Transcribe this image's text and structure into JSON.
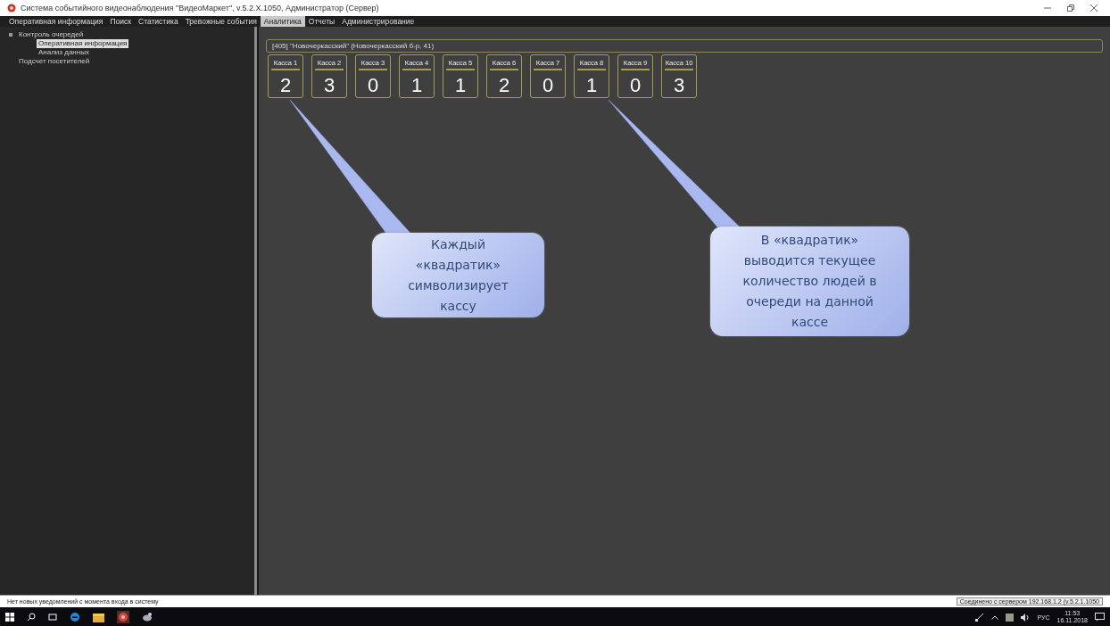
{
  "window": {
    "title": "Система событийного видеонаблюдения \"ВидеоМаркет\", v.5.2.X.1050, Администратор (Сервер)"
  },
  "menu": [
    {
      "label": "Оперативная информация",
      "selected": false
    },
    {
      "label": "Поиск",
      "selected": false
    },
    {
      "label": "Статистика",
      "selected": false
    },
    {
      "label": "Тревожные события",
      "selected": false
    },
    {
      "label": "Аналитика",
      "selected": true
    },
    {
      "label": "Отчеты",
      "selected": false
    },
    {
      "label": "Администрирование",
      "selected": false
    }
  ],
  "sidebar": {
    "items": [
      {
        "label": "Контроль очередей",
        "selected": false,
        "expanded": true,
        "children": [
          {
            "label": "Оперативная информация",
            "selected": true
          },
          {
            "label": "Анализ данных",
            "selected": false
          }
        ]
      },
      {
        "label": "Подсчет посетителей",
        "selected": false
      }
    ]
  },
  "store": {
    "title": "[405] \"Новочеркасский\" (Новочеркасский б-р, 41)"
  },
  "registers": [
    {
      "label": "Касса 1",
      "count": "2"
    },
    {
      "label": "Касса 2",
      "count": "3"
    },
    {
      "label": "Касса 3",
      "count": "0"
    },
    {
      "label": "Касса 4",
      "count": "1"
    },
    {
      "label": "Касса 5",
      "count": "1"
    },
    {
      "label": "Касса 6",
      "count": "2"
    },
    {
      "label": "Касса 7",
      "count": "0"
    },
    {
      "label": "Касса 8",
      "count": "1"
    },
    {
      "label": "Касса 9",
      "count": "0"
    },
    {
      "label": "Касса 10",
      "count": "3"
    }
  ],
  "callouts": [
    {
      "text": "Каждый «квадратик» символизирует кассу"
    },
    {
      "text": "В «квадратик» выводится текущее количество людей в очереди на данной кассе"
    }
  ],
  "status_bar": {
    "message": "Нет новых уведомлений с момента входа в систему",
    "connection": "Соединено с сервером 192.168.1.2 (v.5.2.1.1050"
  },
  "taskbar": {
    "language": "РУС",
    "time": "11:53",
    "date": "16.11.2018"
  }
}
